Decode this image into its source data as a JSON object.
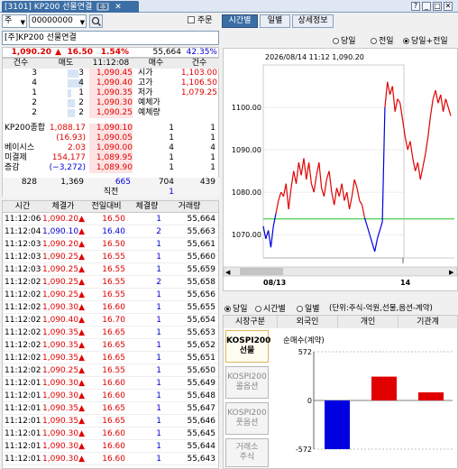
{
  "window": {
    "title": "[3101] KP200 선물연결",
    "badge": "E3",
    "close": "✕",
    "ctrl_help": "?",
    "ctrl_min": "_",
    "ctrl_max": "□",
    "ctrl_close": "✕"
  },
  "toolbar": {
    "select1": "주",
    "code": "00000000",
    "check_label": "주문",
    "tabs": [
      "시간별",
      "일별",
      "상세정보"
    ]
  },
  "instrument": {
    "name": "[주]KP200 선물연결"
  },
  "price": {
    "last": "1,090.20",
    "arrow": "▲",
    "change": "16.50",
    "rate": "1.54%",
    "volume": "55,664",
    "ratio": "42.35%"
  },
  "orderbook": {
    "headers": [
      "건수",
      "매도",
      "11:12:08",
      "매수",
      "건수"
    ],
    "asks": [
      {
        "cnt": "3",
        "qty": "3",
        "price": "1,090.45",
        "label": "시가",
        "val": "1,103.00"
      },
      {
        "cnt": "4",
        "qty": "4",
        "price": "1,090.40",
        "label": "고가",
        "val": "1,106.50"
      },
      {
        "cnt": "1",
        "qty": "1",
        "price": "1,090.35",
        "label": "저가",
        "val": "1,079.25"
      },
      {
        "cnt": "2",
        "qty": "2",
        "price": "1,090.30",
        "label": "예체가",
        "val": ""
      },
      {
        "cnt": "2",
        "qty": "2",
        "price": "1,090.25",
        "label": "예체량",
        "val": ""
      }
    ],
    "bids": [
      {
        "label": "KP200종합",
        "lval": "1,088.17",
        "price": "1,090.10",
        "qty": "1",
        "cnt": "1"
      },
      {
        "label": "",
        "lval": "(16.93)",
        "price": "1,090.05",
        "qty": "1",
        "cnt": "1"
      },
      {
        "label": "베이시스",
        "lval": "2.03",
        "price": "1,090.00",
        "qty": "4",
        "cnt": "4"
      },
      {
        "label": "미결제",
        "lval": "154,177",
        "price": "1,089.95",
        "qty": "1",
        "cnt": "1"
      },
      {
        "label": "증감",
        "lval": "(−3,272)",
        "price": "1,089.90",
        "qty": "1",
        "cnt": "1"
      }
    ],
    "totals": {
      "ask_cnt": "828",
      "ask_qty": "1,369",
      "mid": "665",
      "bid_qty": "704",
      "bid_cnt": "439",
      "label": "직전",
      "last": "1"
    }
  },
  "ticks": {
    "headers": [
      "시간",
      "체결가",
      "전일대비",
      "체결량",
      "거래량"
    ],
    "rows": [
      [
        "11:12:06",
        "1,090.20",
        "16.50",
        "1",
        "55,664",
        "r"
      ],
      [
        "11:12:04",
        "1,090.10",
        "16.40",
        "2",
        "55,663",
        "b"
      ],
      [
        "11:12:03",
        "1,090.20",
        "16.50",
        "1",
        "55,661",
        "r"
      ],
      [
        "11:12:03",
        "1,090.25",
        "16.55",
        "1",
        "55,660",
        "r"
      ],
      [
        "11:12:03",
        "1,090.25",
        "16.55",
        "1",
        "55,659",
        "r"
      ],
      [
        "11:12:02",
        "1,090.25",
        "16.55",
        "2",
        "55,658",
        "r"
      ],
      [
        "11:12:02",
        "1,090.25",
        "16.55",
        "1",
        "55,656",
        "r"
      ],
      [
        "11:12:02",
        "1,090.30",
        "16.60",
        "1",
        "55,655",
        "r"
      ],
      [
        "11:12:02",
        "1,090.40",
        "16.70",
        "1",
        "55,654",
        "r"
      ],
      [
        "11:12:02",
        "1,090.35",
        "16.65",
        "1",
        "55,653",
        "r"
      ],
      [
        "11:12:02",
        "1,090.35",
        "16.65",
        "1",
        "55,652",
        "r"
      ],
      [
        "11:12:02",
        "1,090.35",
        "16.65",
        "1",
        "55,651",
        "r"
      ],
      [
        "11:12:02",
        "1,090.25",
        "16.55",
        "1",
        "55,650",
        "r"
      ],
      [
        "11:12:01",
        "1,090.30",
        "16.60",
        "1",
        "55,649",
        "r"
      ],
      [
        "11:12:01",
        "1,090.30",
        "16.60",
        "1",
        "55,648",
        "r"
      ],
      [
        "11:12:01",
        "1,090.35",
        "16.65",
        "1",
        "55,647",
        "r"
      ],
      [
        "11:12:01",
        "1,090.35",
        "16.65",
        "1",
        "55,646",
        "r"
      ],
      [
        "11:12:01",
        "1,090.30",
        "16.60",
        "1",
        "55,645",
        "r"
      ],
      [
        "11:12:01",
        "1,090.30",
        "16.60",
        "1",
        "55,644",
        "r"
      ],
      [
        "11:12:01",
        "1,090.30",
        "16.60",
        "1",
        "55,643",
        "r"
      ]
    ]
  },
  "chart_options": {
    "label1": "당일",
    "label2": "전일",
    "label3": "당일+전일",
    "selected": "당일+전일"
  },
  "chart_data": [
    {
      "type": "line",
      "header": "2026/08/14 11:12 1,090.20",
      "yticks": [
        1070,
        1080,
        1090,
        1100
      ],
      "ytick_labels": [
        "1070.00",
        "1080.00",
        "1090.00",
        "1100.00"
      ],
      "xlabels": [
        "08/13",
        "14"
      ],
      "ylim": [
        1064.5,
        1110
      ],
      "ref_line": 1073.7,
      "colors": {
        "up": "#e00000",
        "down": "#0000e0",
        "ref": "#20c020"
      },
      "series": [
        {
          "color": "up",
          "values": [
            1072,
            1069,
            1071,
            1067,
            1072,
            1075,
            1078,
            1080,
            1079,
            1082,
            1076,
            1081,
            1085,
            1082,
            1087,
            1084,
            1088,
            1083,
            1087,
            1082,
            1080,
            1084,
            1087,
            1081,
            1079,
            1083,
            1085,
            1080,
            1077,
            1081,
            1079,
            1082,
            1078,
            1080,
            1076,
            1079,
            1083,
            1081,
            1078,
            1077,
            1074,
            1072,
            1070,
            1068,
            1066,
            1069,
            1071,
            1073,
            1100,
            1106,
            1103,
            1105,
            1099,
            1102,
            1101,
            1097,
            1093,
            1090,
            1092,
            1088,
            1085,
            1087,
            1083,
            1086,
            1089,
            1093,
            1098,
            1102,
            1104,
            1101,
            1103,
            1099,
            1102,
            1100,
            1098
          ]
        }
      ]
    },
    {
      "type": "bar",
      "title": "순매수(계약)",
      "categories": [
        "외국인",
        "개인",
        "기관계"
      ],
      "values": [
        -572,
        280,
        95
      ],
      "colors": [
        "#0000e0",
        "#e00000",
        "#e00000"
      ],
      "ylim": [
        -572,
        572
      ],
      "ytick_labels": [
        "572",
        "0",
        "-572"
      ]
    }
  ],
  "investor": {
    "radio": {
      "opt1": "당일",
      "opt2": "시간별",
      "opt3": "일별",
      "unit": "(단위:주식-억원,선물,옵션-계약)"
    },
    "headers": [
      "시장구분",
      "외국인",
      "개인",
      "기관계"
    ],
    "buttons": [
      "KOSPI200\n선물",
      "KOSPI200\n콜옵션",
      "KOSPI200\n풋옵션",
      "거래소\n주식"
    ]
  }
}
